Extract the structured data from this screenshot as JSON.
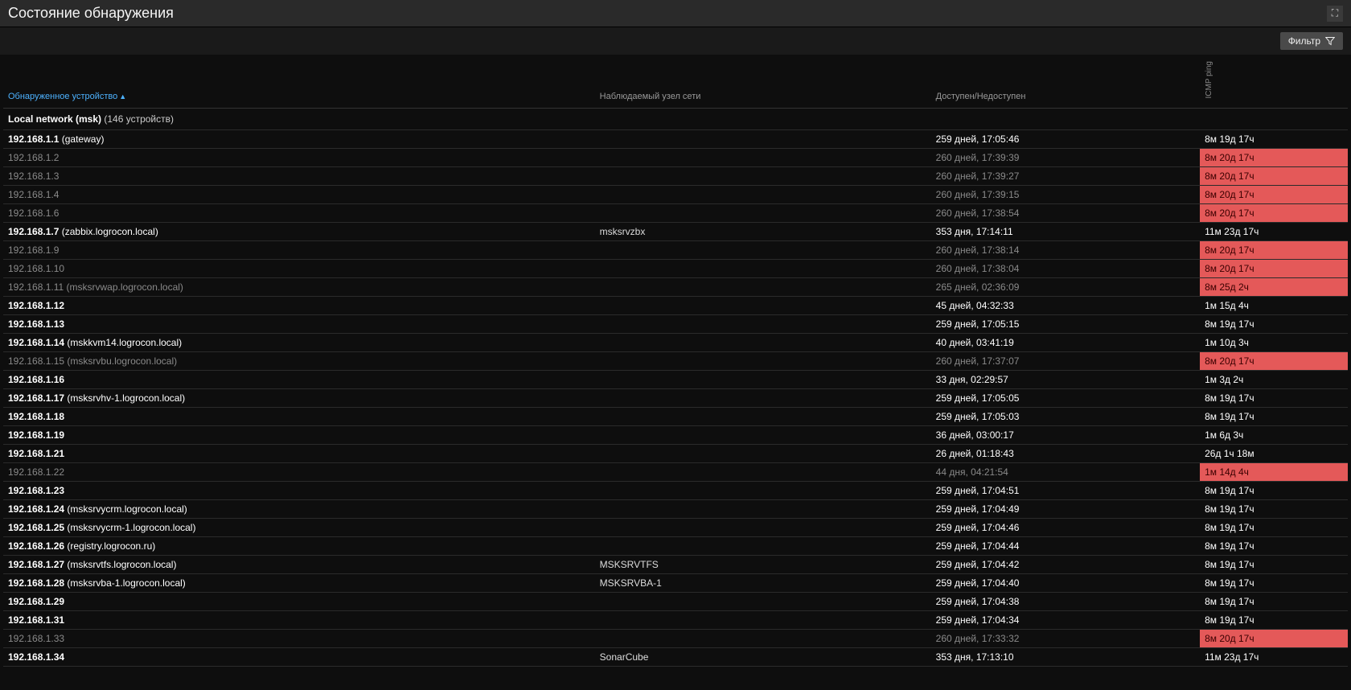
{
  "header": {
    "title": "Состояние обнаружения",
    "fullscreen_icon": "⛶"
  },
  "filter": {
    "label": "Фильтр"
  },
  "columns": {
    "device": "Обнаруженное устройство",
    "node": "Наблюдаемый узел сети",
    "availability": "Доступен/Недоступен",
    "icmp": "ICMP ping"
  },
  "group": {
    "name": "Local network (msk)",
    "count_label": "(146 устройств)"
  },
  "rows": [
    {
      "ip": "192.168.1.1",
      "extra": "(gateway)",
      "node": "",
      "avail": "259 дней, 17:05:46",
      "icmp": "8м 19д 17ч",
      "status": "up",
      "icmp_red": false
    },
    {
      "ip": "192.168.1.2",
      "extra": "",
      "node": "",
      "avail": "260 дней, 17:39:39",
      "icmp": "8м 20д 17ч",
      "status": "down",
      "icmp_red": true
    },
    {
      "ip": "192.168.1.3",
      "extra": "",
      "node": "",
      "avail": "260 дней, 17:39:27",
      "icmp": "8м 20д 17ч",
      "status": "down",
      "icmp_red": true
    },
    {
      "ip": "192.168.1.4",
      "extra": "",
      "node": "",
      "avail": "260 дней, 17:39:15",
      "icmp": "8м 20д 17ч",
      "status": "down",
      "icmp_red": true
    },
    {
      "ip": "192.168.1.6",
      "extra": "",
      "node": "",
      "avail": "260 дней, 17:38:54",
      "icmp": "8м 20д 17ч",
      "status": "down",
      "icmp_red": true
    },
    {
      "ip": "192.168.1.7",
      "extra": "(zabbix.logrocon.local)",
      "node": "msksrvzbx",
      "avail": "353 дня, 17:14:11",
      "icmp": "11м 23д 17ч",
      "status": "up",
      "icmp_red": false
    },
    {
      "ip": "192.168.1.9",
      "extra": "",
      "node": "",
      "avail": "260 дней, 17:38:14",
      "icmp": "8м 20д 17ч",
      "status": "down",
      "icmp_red": true
    },
    {
      "ip": "192.168.1.10",
      "extra": "",
      "node": "",
      "avail": "260 дней, 17:38:04",
      "icmp": "8м 20д 17ч",
      "status": "down",
      "icmp_red": true
    },
    {
      "ip": "192.168.1.11",
      "extra": "(msksrvwap.logrocon.local)",
      "node": "",
      "avail": "265 дней, 02:36:09",
      "icmp": "8м 25д 2ч",
      "status": "down",
      "icmp_red": true
    },
    {
      "ip": "192.168.1.12",
      "extra": "",
      "node": "",
      "avail": "45 дней, 04:32:33",
      "icmp": "1м 15д 4ч",
      "status": "up",
      "icmp_red": false
    },
    {
      "ip": "192.168.1.13",
      "extra": "",
      "node": "",
      "avail": "259 дней, 17:05:15",
      "icmp": "8м 19д 17ч",
      "status": "up",
      "icmp_red": false
    },
    {
      "ip": "192.168.1.14",
      "extra": "(mskkvm14.logrocon.local)",
      "node": "",
      "avail": "40 дней, 03:41:19",
      "icmp": "1м 10д 3ч",
      "status": "up",
      "icmp_red": false
    },
    {
      "ip": "192.168.1.15",
      "extra": "(msksrvbu.logrocon.local)",
      "node": "",
      "avail": "260 дней, 17:37:07",
      "icmp": "8м 20д 17ч",
      "status": "down",
      "icmp_red": true
    },
    {
      "ip": "192.168.1.16",
      "extra": "",
      "node": "",
      "avail": "33 дня, 02:29:57",
      "icmp": "1м 3д 2ч",
      "status": "up",
      "icmp_red": false
    },
    {
      "ip": "192.168.1.17",
      "extra": "(msksrvhv-1.logrocon.local)",
      "node": "",
      "avail": "259 дней, 17:05:05",
      "icmp": "8м 19д 17ч",
      "status": "up",
      "icmp_red": false
    },
    {
      "ip": "192.168.1.18",
      "extra": "",
      "node": "",
      "avail": "259 дней, 17:05:03",
      "icmp": "8м 19д 17ч",
      "status": "up",
      "icmp_red": false
    },
    {
      "ip": "192.168.1.19",
      "extra": "",
      "node": "",
      "avail": "36 дней, 03:00:17",
      "icmp": "1м 6д 3ч",
      "status": "up",
      "icmp_red": false
    },
    {
      "ip": "192.168.1.21",
      "extra": "",
      "node": "",
      "avail": "26 дней, 01:18:43",
      "icmp": "26д 1ч 18м",
      "status": "up",
      "icmp_red": false
    },
    {
      "ip": "192.168.1.22",
      "extra": "",
      "node": "",
      "avail": "44 дня, 04:21:54",
      "icmp": "1м 14д 4ч",
      "status": "down",
      "icmp_red": true
    },
    {
      "ip": "192.168.1.23",
      "extra": "",
      "node": "",
      "avail": "259 дней, 17:04:51",
      "icmp": "8м 19д 17ч",
      "status": "up",
      "icmp_red": false
    },
    {
      "ip": "192.168.1.24",
      "extra": "(msksrvycrm.logrocon.local)",
      "node": "",
      "avail": "259 дней, 17:04:49",
      "icmp": "8м 19д 17ч",
      "status": "up",
      "icmp_red": false
    },
    {
      "ip": "192.168.1.25",
      "extra": "(msksrvycrm-1.logrocon.local)",
      "node": "",
      "avail": "259 дней, 17:04:46",
      "icmp": "8м 19д 17ч",
      "status": "up",
      "icmp_red": false
    },
    {
      "ip": "192.168.1.26",
      "extra": "(registry.logrocon.ru)",
      "node": "",
      "avail": "259 дней, 17:04:44",
      "icmp": "8м 19д 17ч",
      "status": "up",
      "icmp_red": false
    },
    {
      "ip": "192.168.1.27",
      "extra": "(msksrvtfs.logrocon.local)",
      "node": "MSKSRVTFS",
      "avail": "259 дней, 17:04:42",
      "icmp": "8м 19д 17ч",
      "status": "up",
      "icmp_red": false
    },
    {
      "ip": "192.168.1.28",
      "extra": "(msksrvba-1.logrocon.local)",
      "node": "MSKSRVBA-1",
      "avail": "259 дней, 17:04:40",
      "icmp": "8м 19д 17ч",
      "status": "up",
      "icmp_red": false
    },
    {
      "ip": "192.168.1.29",
      "extra": "",
      "node": "",
      "avail": "259 дней, 17:04:38",
      "icmp": "8м 19д 17ч",
      "status": "up",
      "icmp_red": false
    },
    {
      "ip": "192.168.1.31",
      "extra": "",
      "node": "",
      "avail": "259 дней, 17:04:34",
      "icmp": "8м 19д 17ч",
      "status": "up",
      "icmp_red": false
    },
    {
      "ip": "192.168.1.33",
      "extra": "",
      "node": "",
      "avail": "260 дней, 17:33:32",
      "icmp": "8м 20д 17ч",
      "status": "down",
      "icmp_red": true
    },
    {
      "ip": "192.168.1.34",
      "extra": "",
      "node": "SonarCube",
      "avail": "353 дня, 17:13:10",
      "icmp": "11м 23д 17ч",
      "status": "up",
      "icmp_red": false
    }
  ]
}
